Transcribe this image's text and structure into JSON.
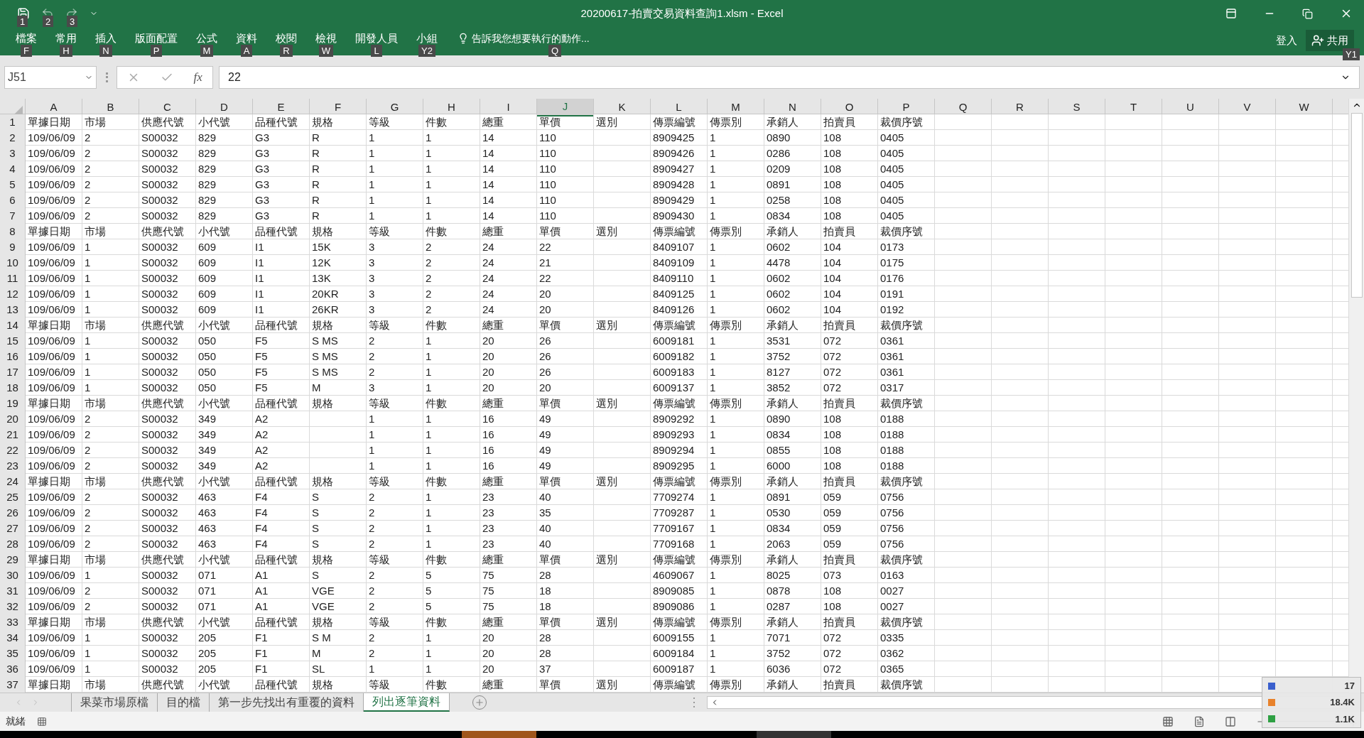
{
  "window": {
    "title": "20200617-拍賣交易資料查詢1.xlsm - Excel",
    "quick_access_keytips": [
      "1",
      "2",
      "3"
    ]
  },
  "ribbon": {
    "tabs": [
      {
        "label": "檔案",
        "keytip": "F"
      },
      {
        "label": "常用",
        "keytip": "H"
      },
      {
        "label": "插入",
        "keytip": "N"
      },
      {
        "label": "版面配置",
        "keytip": "P"
      },
      {
        "label": "公式",
        "keytip": "M"
      },
      {
        "label": "資料",
        "keytip": "A"
      },
      {
        "label": "校閱",
        "keytip": "R"
      },
      {
        "label": "檢視",
        "keytip": "W"
      },
      {
        "label": "開發人員",
        "keytip": "L"
      },
      {
        "label": "小組",
        "keytip": "Y2"
      }
    ],
    "tell_me": {
      "label": "告訴我您想要執行的動作...",
      "keytip": "Q"
    },
    "sign_in": "登入",
    "share": {
      "label": "共用",
      "keytip": "Y1"
    }
  },
  "formula_bar": {
    "name_box": "J51",
    "function_button": "fx",
    "value": "22"
  },
  "columns": [
    {
      "label": "A",
      "selected": false
    },
    {
      "label": "B",
      "selected": false
    },
    {
      "label": "C",
      "selected": false
    },
    {
      "label": "D",
      "selected": false
    },
    {
      "label": "E",
      "selected": false
    },
    {
      "label": "F",
      "selected": false
    },
    {
      "label": "G",
      "selected": false
    },
    {
      "label": "H",
      "selected": false
    },
    {
      "label": "I",
      "selected": false
    },
    {
      "label": "J",
      "selected": true
    },
    {
      "label": "K",
      "selected": false
    },
    {
      "label": "L",
      "selected": false
    },
    {
      "label": "M",
      "selected": false
    },
    {
      "label": "N",
      "selected": false
    },
    {
      "label": "O",
      "selected": false
    },
    {
      "label": "P",
      "selected": false
    },
    {
      "label": "Q",
      "selected": false
    },
    {
      "label": "R",
      "selected": false
    },
    {
      "label": "S",
      "selected": false
    },
    {
      "label": "T",
      "selected": false
    },
    {
      "label": "U",
      "selected": false
    },
    {
      "label": "V",
      "selected": false
    },
    {
      "label": "W",
      "selected": false
    }
  ],
  "rows": [
    {
      "number": "1",
      "cells": [
        "單據日期",
        "市場",
        "供應代號",
        "小代號",
        "品種代號",
        "規格",
        "等級",
        "件數",
        "總重",
        "單價",
        "選別",
        "傳票編號",
        "傳票別",
        "承銷人",
        "拍賣員",
        "裁價序號"
      ]
    },
    {
      "number": "2",
      "cells": [
        "109/06/09",
        "2",
        "S00032",
        "829",
        "G3",
        "R",
        "1",
        "1",
        "14",
        "110",
        null,
        "8909425",
        "1",
        "0890",
        "108",
        "0405"
      ]
    },
    {
      "number": "3",
      "cells": [
        "109/06/09",
        "2",
        "S00032",
        "829",
        "G3",
        "R",
        "1",
        "1",
        "14",
        "110",
        null,
        "8909426",
        "1",
        "0286",
        "108",
        "0405"
      ]
    },
    {
      "number": "4",
      "cells": [
        "109/06/09",
        "2",
        "S00032",
        "829",
        "G3",
        "R",
        "1",
        "1",
        "14",
        "110",
        null,
        "8909427",
        "1",
        "0209",
        "108",
        "0405"
      ]
    },
    {
      "number": "5",
      "cells": [
        "109/06/09",
        "2",
        "S00032",
        "829",
        "G3",
        "R",
        "1",
        "1",
        "14",
        "110",
        null,
        "8909428",
        "1",
        "0891",
        "108",
        "0405"
      ]
    },
    {
      "number": "6",
      "cells": [
        "109/06/09",
        "2",
        "S00032",
        "829",
        "G3",
        "R",
        "1",
        "1",
        "14",
        "110",
        null,
        "8909429",
        "1",
        "0258",
        "108",
        "0405"
      ]
    },
    {
      "number": "7",
      "cells": [
        "109/06/09",
        "2",
        "S00032",
        "829",
        "G3",
        "R",
        "1",
        "1",
        "14",
        "110",
        null,
        "8909430",
        "1",
        "0834",
        "108",
        "0405"
      ]
    },
    {
      "number": "8",
      "cells": [
        "單據日期",
        "市場",
        "供應代號",
        "小代號",
        "品種代號",
        "規格",
        "等級",
        "件數",
        "總重",
        "單價",
        "選別",
        "傳票編號",
        "傳票別",
        "承銷人",
        "拍賣員",
        "裁價序號"
      ]
    },
    {
      "number": "9",
      "cells": [
        "109/06/09",
        "1",
        "S00032",
        "609",
        "I1",
        "15K",
        "3",
        "2",
        "24",
        "22",
        null,
        "8409107",
        "1",
        "0602",
        "104",
        "0173"
      ]
    },
    {
      "number": "10",
      "cells": [
        "109/06/09",
        "1",
        "S00032",
        "609",
        "I1",
        "12K",
        "3",
        "2",
        "24",
        "21",
        null,
        "8409109",
        "1",
        "4478",
        "104",
        "0175"
      ]
    },
    {
      "number": "11",
      "cells": [
        "109/06/09",
        "1",
        "S00032",
        "609",
        "I1",
        "13K",
        "3",
        "2",
        "24",
        "22",
        null,
        "8409110",
        "1",
        "0602",
        "104",
        "0176"
      ]
    },
    {
      "number": "12",
      "cells": [
        "109/06/09",
        "1",
        "S00032",
        "609",
        "I1",
        "20KR",
        "3",
        "2",
        "24",
        "20",
        null,
        "8409125",
        "1",
        "0602",
        "104",
        "0191"
      ]
    },
    {
      "number": "13",
      "cells": [
        "109/06/09",
        "1",
        "S00032",
        "609",
        "I1",
        "26KR",
        "3",
        "2",
        "24",
        "20",
        null,
        "8409126",
        "1",
        "0602",
        "104",
        "0192"
      ]
    },
    {
      "number": "14",
      "cells": [
        "單據日期",
        "市場",
        "供應代號",
        "小代號",
        "品種代號",
        "規格",
        "等級",
        "件數",
        "總重",
        "單價",
        "選別",
        "傳票編號",
        "傳票別",
        "承銷人",
        "拍賣員",
        "裁價序號"
      ]
    },
    {
      "number": "15",
      "cells": [
        "109/06/09",
        "1",
        "S00032",
        "050",
        "F5",
        "S MS",
        "2",
        "1",
        "20",
        "26",
        null,
        "6009181",
        "1",
        "3531",
        "072",
        "0361"
      ]
    },
    {
      "number": "16",
      "cells": [
        "109/06/09",
        "1",
        "S00032",
        "050",
        "F5",
        "S MS",
        "2",
        "1",
        "20",
        "26",
        null,
        "6009182",
        "1",
        "3752",
        "072",
        "0361"
      ]
    },
    {
      "number": "17",
      "cells": [
        "109/06/09",
        "1",
        "S00032",
        "050",
        "F5",
        "S MS",
        "2",
        "1",
        "20",
        "26",
        null,
        "6009183",
        "1",
        "8127",
        "072",
        "0361"
      ]
    },
    {
      "number": "18",
      "cells": [
        "109/06/09",
        "1",
        "S00032",
        "050",
        "F5",
        "M",
        "3",
        "1",
        "20",
        "20",
        null,
        "6009137",
        "1",
        "3852",
        "072",
        "0317"
      ]
    },
    {
      "number": "19",
      "cells": [
        "單據日期",
        "市場",
        "供應代號",
        "小代號",
        "品種代號",
        "規格",
        "等級",
        "件數",
        "總重",
        "單價",
        "選別",
        "傳票編號",
        "傳票別",
        "承銷人",
        "拍賣員",
        "裁價序號"
      ]
    },
    {
      "number": "20",
      "cells": [
        "109/06/09",
        "2",
        "S00032",
        "349",
        "A2",
        null,
        "1",
        "1",
        "16",
        "49",
        null,
        "8909292",
        "1",
        "0890",
        "108",
        "0188"
      ]
    },
    {
      "number": "21",
      "cells": [
        "109/06/09",
        "2",
        "S00032",
        "349",
        "A2",
        null,
        "1",
        "1",
        "16",
        "49",
        null,
        "8909293",
        "1",
        "0834",
        "108",
        "0188"
      ]
    },
    {
      "number": "22",
      "cells": [
        "109/06/09",
        "2",
        "S00032",
        "349",
        "A2",
        null,
        "1",
        "1",
        "16",
        "49",
        null,
        "8909294",
        "1",
        "0855",
        "108",
        "0188"
      ]
    },
    {
      "number": "23",
      "cells": [
        "109/06/09",
        "2",
        "S00032",
        "349",
        "A2",
        null,
        "1",
        "1",
        "16",
        "49",
        null,
        "8909295",
        "1",
        "6000",
        "108",
        "0188"
      ]
    },
    {
      "number": "24",
      "cells": [
        "單據日期",
        "市場",
        "供應代號",
        "小代號",
        "品種代號",
        "規格",
        "等級",
        "件數",
        "總重",
        "單價",
        "選別",
        "傳票編號",
        "傳票別",
        "承銷人",
        "拍賣員",
        "裁價序號"
      ]
    },
    {
      "number": "25",
      "cells": [
        "109/06/09",
        "2",
        "S00032",
        "463",
        "F4",
        "S",
        "2",
        "1",
        "23",
        "40",
        null,
        "7709274",
        "1",
        "0891",
        "059",
        "0756"
      ]
    },
    {
      "number": "26",
      "cells": [
        "109/06/09",
        "2",
        "S00032",
        "463",
        "F4",
        "S",
        "2",
        "1",
        "23",
        "35",
        null,
        "7709287",
        "1",
        "0530",
        "059",
        "0756"
      ]
    },
    {
      "number": "27",
      "cells": [
        "109/06/09",
        "2",
        "S00032",
        "463",
        "F4",
        "S",
        "2",
        "1",
        "23",
        "40",
        null,
        "7709167",
        "1",
        "0834",
        "059",
        "0756"
      ]
    },
    {
      "number": "28",
      "cells": [
        "109/06/09",
        "2",
        "S00032",
        "463",
        "F4",
        "S",
        "2",
        "1",
        "23",
        "40",
        null,
        "7709168",
        "1",
        "2063",
        "059",
        "0756"
      ]
    },
    {
      "number": "29",
      "cells": [
        "單據日期",
        "市場",
        "供應代號",
        "小代號",
        "品種代號",
        "規格",
        "等級",
        "件數",
        "總重",
        "單價",
        "選別",
        "傳票編號",
        "傳票別",
        "承銷人",
        "拍賣員",
        "裁價序號"
      ]
    },
    {
      "number": "30",
      "cells": [
        "109/06/09",
        "1",
        "S00032",
        "071",
        "A1",
        "S",
        "2",
        "5",
        "75",
        "28",
        null,
        "4609067",
        "1",
        "8025",
        "073",
        "0163"
      ]
    },
    {
      "number": "31",
      "cells": [
        "109/06/09",
        "2",
        "S00032",
        "071",
        "A1",
        "VGE",
        "2",
        "5",
        "75",
        "18",
        null,
        "8909085",
        "1",
        "0878",
        "108",
        "0027"
      ]
    },
    {
      "number": "32",
      "cells": [
        "109/06/09",
        "2",
        "S00032",
        "071",
        "A1",
        "VGE",
        "2",
        "5",
        "75",
        "18",
        null,
        "8909086",
        "1",
        "0287",
        "108",
        "0027"
      ]
    },
    {
      "number": "33",
      "cells": [
        "單據日期",
        "市場",
        "供應代號",
        "小代號",
        "品種代號",
        "規格",
        "等級",
        "件數",
        "總重",
        "單價",
        "選別",
        "傳票編號",
        "傳票別",
        "承銷人",
        "拍賣員",
        "裁價序號"
      ]
    },
    {
      "number": "34",
      "cells": [
        "109/06/09",
        "1",
        "S00032",
        "205",
        "F1",
        "S M",
        "2",
        "1",
        "20",
        "28",
        null,
        "6009155",
        "1",
        "7071",
        "072",
        "0335"
      ]
    },
    {
      "number": "35",
      "cells": [
        "109/06/09",
        "1",
        "S00032",
        "205",
        "F1",
        "M",
        "2",
        "1",
        "20",
        "28",
        null,
        "6009184",
        "1",
        "3752",
        "072",
        "0362"
      ]
    },
    {
      "number": "36",
      "cells": [
        "109/06/09",
        "1",
        "S00032",
        "205",
        "F1",
        "SL",
        "1",
        "1",
        "20",
        "37",
        null,
        "6009187",
        "1",
        "6036",
        "072",
        "0365"
      ]
    },
    {
      "number": "37",
      "cells": [
        "單據日期",
        "市場",
        "供應代號",
        "小代號",
        "品種代號",
        "規格",
        "等級",
        "件數",
        "總重",
        "單價",
        "選別",
        "傳票編號",
        "傳票別",
        "承銷人",
        "拍賣員",
        "裁價序號"
      ]
    }
  ],
  "sheets": [
    {
      "label": "果菜市場原檔",
      "selected": false
    },
    {
      "label": "目的檔",
      "selected": false
    },
    {
      "label": "第一步先找出有重覆的資料",
      "selected": false
    },
    {
      "label": "列出逐筆資料",
      "selected": true
    }
  ],
  "status_bar": {
    "text": "就緒"
  },
  "monitor_overlay": {
    "readings": [
      "17",
      "18.4K",
      "1.1K"
    ]
  }
}
